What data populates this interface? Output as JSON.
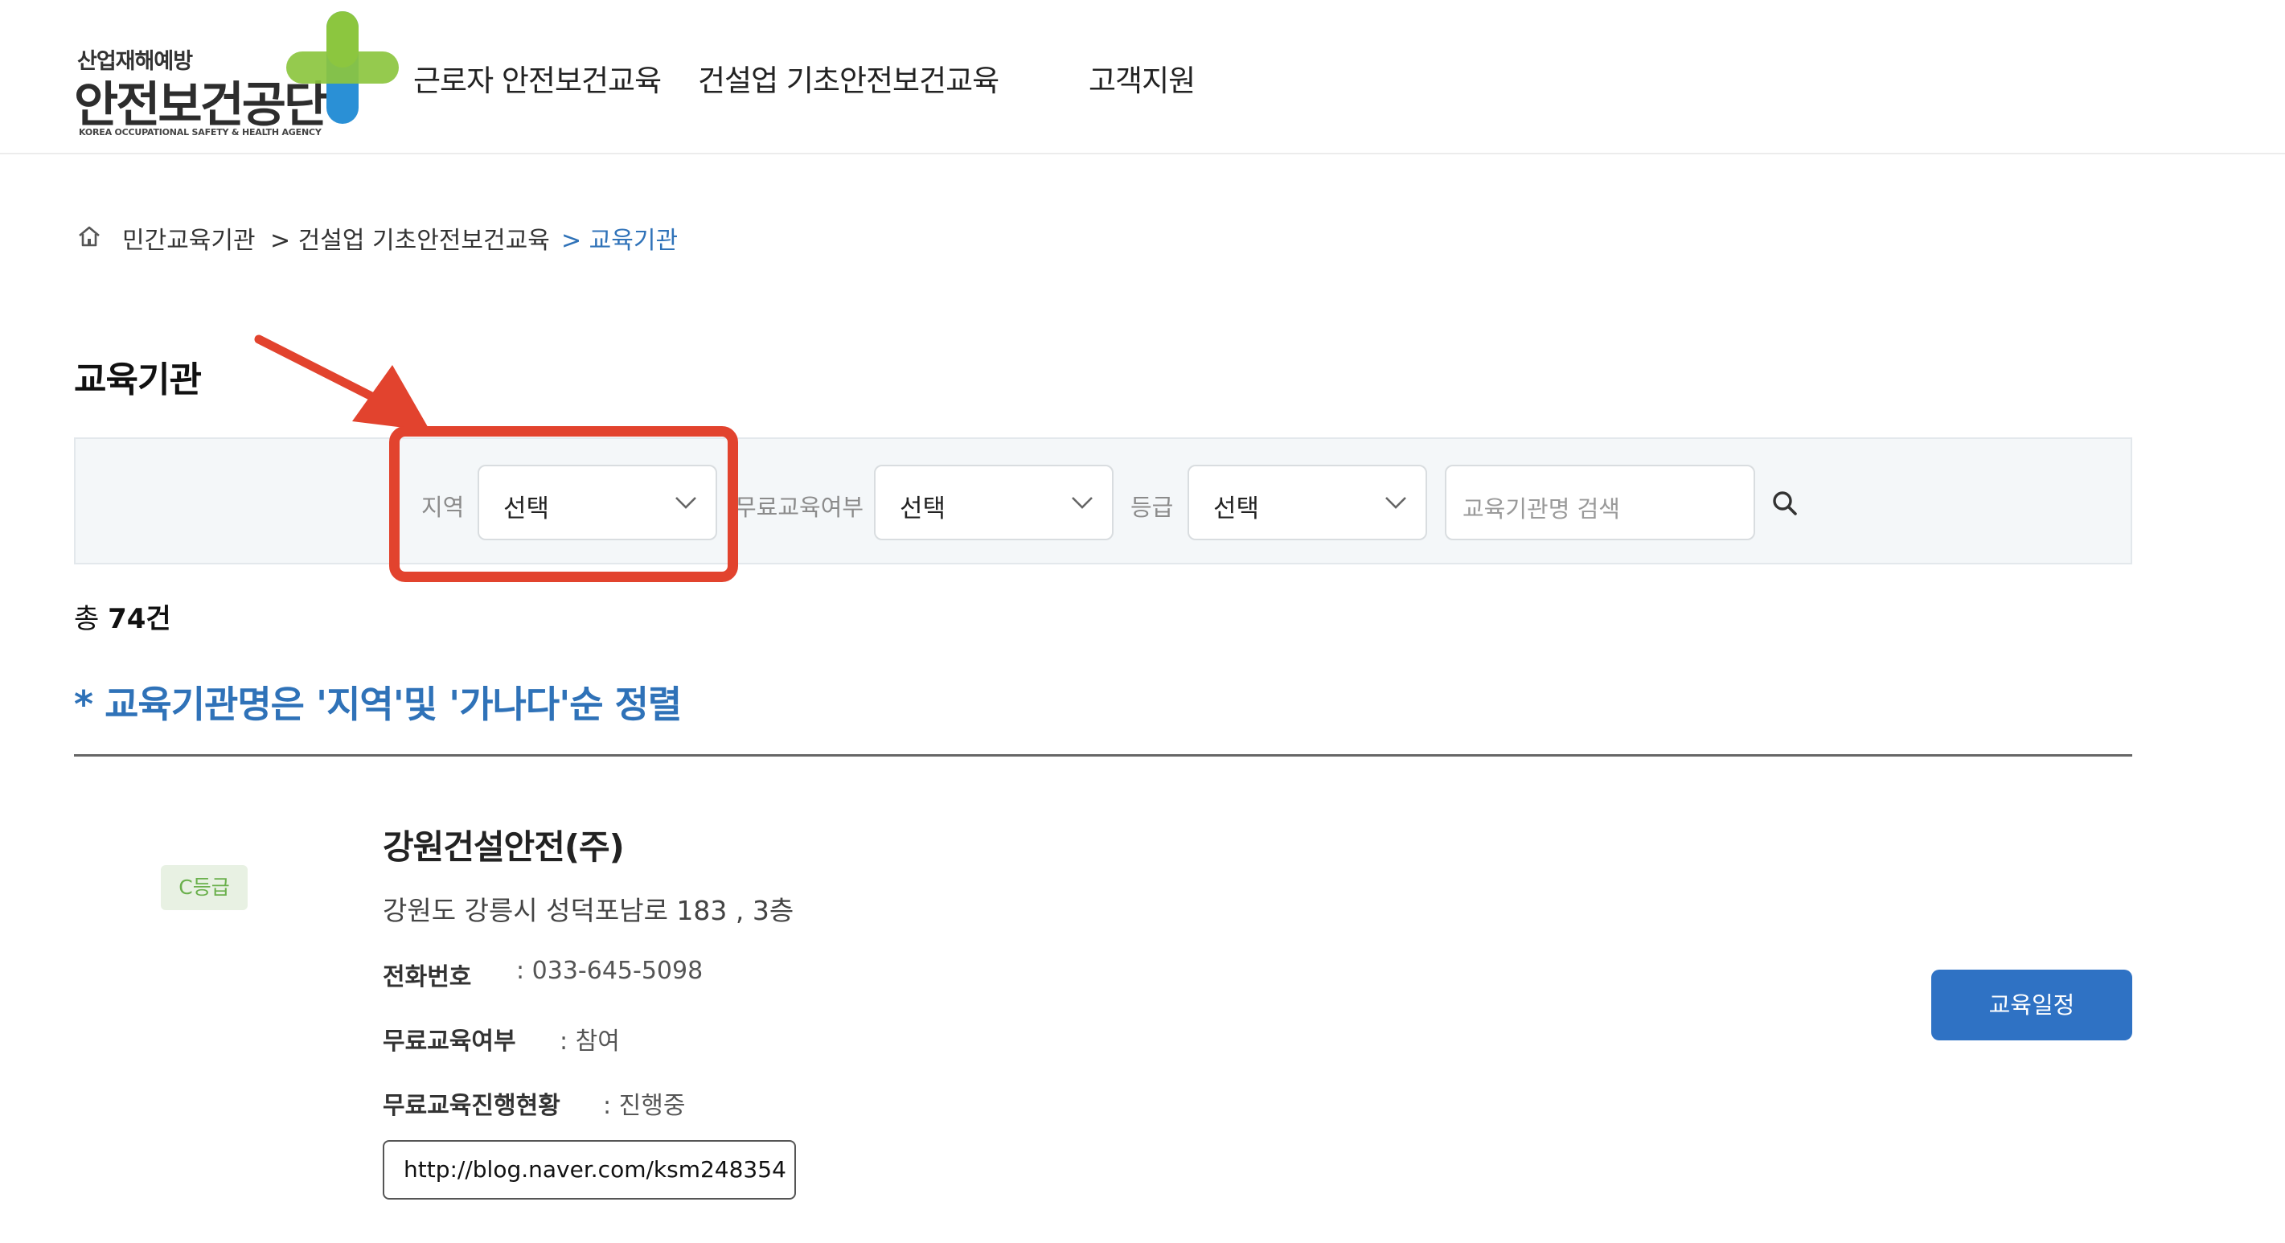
{
  "header": {
    "logo": {
      "subtitle": "산업재해예방",
      "title": "안전보건공단",
      "english": "KOREA OCCUPATIONAL SAFETY & HEALTH AGENCY"
    },
    "nav": [
      "근로자 안전보건교육",
      "건설업 기초안전보건교육",
      "고객지원"
    ]
  },
  "breadcrumb": {
    "home_icon": "home-icon",
    "items": [
      "민간교육기관",
      "> 건설업 기초안전보건교육",
      "> 교육기관"
    ],
    "active_color": "#2f72b8"
  },
  "page": {
    "title": "교육기관"
  },
  "search": {
    "region": {
      "label": "지역",
      "value": "선택"
    },
    "free_edu": {
      "label": "무료교육여부",
      "value": "선택"
    },
    "grade": {
      "label": "등급",
      "value": "선택"
    },
    "keyword": {
      "placeholder": "교육기관명 검색",
      "value": ""
    },
    "search_icon": "search-icon"
  },
  "annotation": {
    "highlight_color": "#e2432e"
  },
  "results": {
    "total_label": "총",
    "total_count": "74건",
    "sort_notice": "* 교육기관명은 '지역'및 '가나다'순 정렬",
    "items": [
      {
        "grade": "C등급",
        "name": "강원건설안전(주)",
        "address": "강원도 강릉시 성덕포남로 183 , 3층",
        "phone_label": "전화번호",
        "phone_value": ": 033-645-5098",
        "free_label": "무료교육여부",
        "free_value": ": 참여",
        "progress_label": "무료교육진행현황",
        "progress_value": ": 진행중",
        "url": "http://blog.naver.com/ksm248354",
        "schedule_button": "교육일정"
      }
    ]
  },
  "colors": {
    "accent": "#2f72c4",
    "grade_badge_bg": "#e8f1e3",
    "grade_badge_text": "#6ab04c"
  }
}
